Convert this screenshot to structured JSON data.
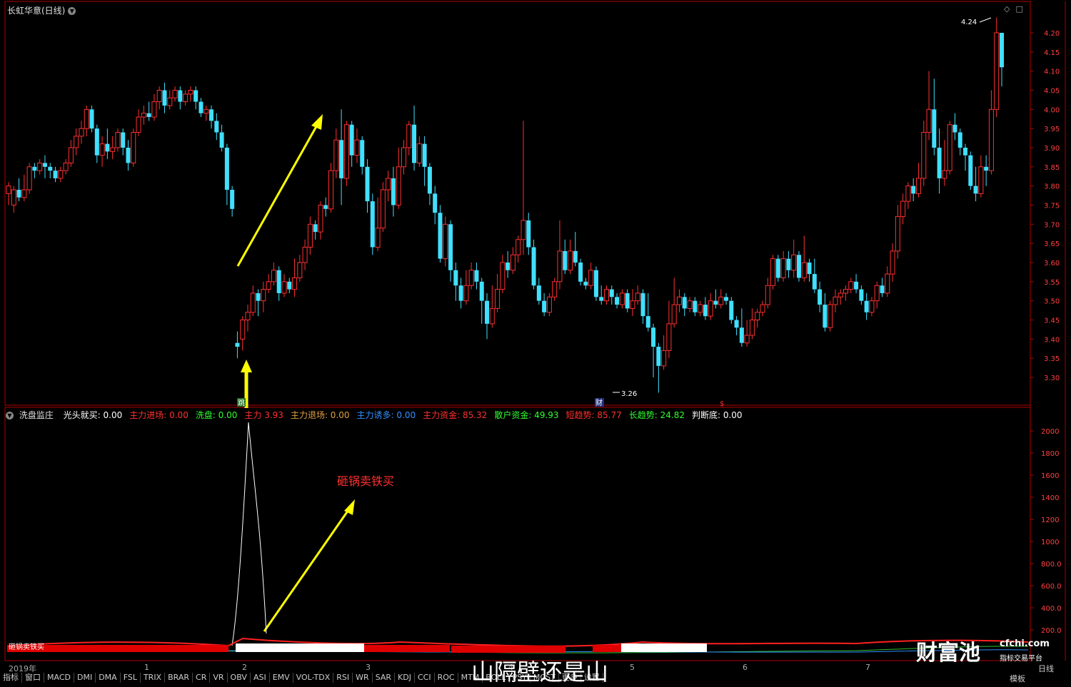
{
  "window": {
    "title": "长虹华意(日线)",
    "period_label": "日线",
    "template_label": "模板"
  },
  "price_axis": {
    "ticks": [
      "4.20",
      "4.15",
      "4.10",
      "4.05",
      "4.00",
      "3.95",
      "3.90",
      "3.85",
      "3.80",
      "3.75",
      "3.70",
      "3.65",
      "3.60",
      "3.55",
      "3.50",
      "3.45",
      "3.40",
      "3.35",
      "3.30"
    ],
    "high_label": "4.24",
    "low_label": "3.26"
  },
  "indicator_axis": {
    "ticks": [
      "2000",
      "1800",
      "1600",
      "1400",
      "1200",
      "1000",
      "800.0",
      "600.0",
      "400.0",
      "200.0"
    ]
  },
  "indicator": {
    "name": "洗盘监庄",
    "fields": [
      {
        "label": "光头就买:",
        "value": "0.00",
        "color": "#ffffff"
      },
      {
        "label": "主力进场:",
        "value": "0.00",
        "color": "#ff3030"
      },
      {
        "label": "洗盘:",
        "value": "0.00",
        "color": "#30ff30"
      },
      {
        "label": "主力",
        "value": "3.93",
        "color": "#ff3030"
      },
      {
        "label": "主力退场:",
        "value": "0.00",
        "color": "#e0a040"
      },
      {
        "label": "主力诱多:",
        "value": "0.00",
        "color": "#3090ff"
      },
      {
        "label": "主力资金:",
        "value": "85.32",
        "color": "#ff3030"
      },
      {
        "label": "散户资金:",
        "value": "49.93",
        "color": "#30ff30"
      },
      {
        "label": "短趋势:",
        "value": "85.77",
        "color": "#ff3030"
      },
      {
        "label": "长趋势:",
        "value": "24.82",
        "color": "#30ff30"
      },
      {
        "label": "判断底:",
        "value": "0.00",
        "color": "#ffffff"
      }
    ]
  },
  "markers": {
    "jump": "跳",
    "cai": "财",
    "dollar": "$"
  },
  "annotation": "砸锅卖铁买",
  "indicator_bar_text": "砸锅卖铁买",
  "date_axis": [
    "2019年",
    "1",
    "2",
    "3",
    "4",
    "5",
    "6",
    "7"
  ],
  "tabs": [
    "指标",
    "窗口",
    "MACD",
    "DMI",
    "DMA",
    "FSL",
    "TRIX",
    "BRAR",
    "CR",
    "VR",
    "OBV",
    "ASI",
    "EMV",
    "VOL-TDX",
    "RSI",
    "WR",
    "SAR",
    "KDJ",
    "CCI",
    "ROC",
    "MTM",
    "BOLL",
    "PSY",
    "MCST",
    "更多",
    "设置"
  ],
  "watermark": "山隔壁还是山",
  "logo": {
    "name": "财富池",
    "url": "cfchi.com",
    "sub": "指标交易平台"
  },
  "candles": [
    [
      3.78,
      3.8,
      3.75,
      3.81
    ],
    [
      3.75,
      3.79,
      3.73,
      3.8
    ],
    [
      3.79,
      3.77,
      3.76,
      3.82
    ],
    [
      3.77,
      3.79,
      3.76,
      3.83
    ],
    [
      3.79,
      3.85,
      3.78,
      3.86
    ],
    [
      3.85,
      3.84,
      3.82,
      3.86
    ],
    [
      3.84,
      3.86,
      3.83,
      3.87
    ],
    [
      3.86,
      3.85,
      3.82,
      3.88
    ],
    [
      3.85,
      3.84,
      3.82,
      3.86
    ],
    [
      3.84,
      3.82,
      3.81,
      3.85
    ],
    [
      3.82,
      3.84,
      3.81,
      3.85
    ],
    [
      3.84,
      3.86,
      3.83,
      3.87
    ],
    [
      3.86,
      3.9,
      3.85,
      3.92
    ],
    [
      3.9,
      3.93,
      3.88,
      3.95
    ],
    [
      3.93,
      3.95,
      3.91,
      3.97
    ],
    [
      3.95,
      4.0,
      3.93,
      4.01
    ],
    [
      4.0,
      3.95,
      3.94,
      4.01
    ],
    [
      3.95,
      3.88,
      3.86,
      3.96
    ],
    [
      3.88,
      3.91,
      3.85,
      3.93
    ],
    [
      3.91,
      3.89,
      3.87,
      3.95
    ],
    [
      3.89,
      3.9,
      3.87,
      3.93
    ],
    [
      3.9,
      3.94,
      3.89,
      3.95
    ],
    [
      3.94,
      3.9,
      3.88,
      3.95
    ],
    [
      3.9,
      3.86,
      3.84,
      3.92
    ],
    [
      3.86,
      3.94,
      3.85,
      3.95
    ],
    [
      3.94,
      3.98,
      3.93,
      4.0
    ],
    [
      3.98,
      3.99,
      3.96,
      4.01
    ],
    [
      3.99,
      3.98,
      3.97,
      4.02
    ],
    [
      3.98,
      4.02,
      3.97,
      4.04
    ],
    [
      4.02,
      4.05,
      4.0,
      4.06
    ],
    [
      4.05,
      4.01,
      3.99,
      4.07
    ],
    [
      4.01,
      4.03,
      4.0,
      4.05
    ],
    [
      4.03,
      4.05,
      4.02,
      4.06
    ],
    [
      4.05,
      4.02,
      4.0,
      4.06
    ],
    [
      4.02,
      4.04,
      4.01,
      4.05
    ],
    [
      4.04,
      4.05,
      4.02,
      4.06
    ],
    [
      4.05,
      4.02,
      4.0,
      4.06
    ],
    [
      4.02,
      3.99,
      3.98,
      4.03
    ],
    [
      3.99,
      4.0,
      3.97,
      4.01
    ],
    [
      4.0,
      3.97,
      3.95,
      4.01
    ],
    [
      3.97,
      3.94,
      3.92,
      3.99
    ],
    [
      3.94,
      3.9,
      3.89,
      3.96
    ],
    [
      3.9,
      3.79,
      3.75,
      3.91
    ],
    [
      3.79,
      3.74,
      3.72,
      3.8
    ],
    [
      3.39,
      3.38,
      3.35,
      3.42
    ],
    [
      3.4,
      3.45,
      3.37,
      3.46
    ],
    [
      3.45,
      3.47,
      3.42,
      3.49
    ],
    [
      3.47,
      3.52,
      3.46,
      3.54
    ],
    [
      3.52,
      3.5,
      3.46,
      3.53
    ],
    [
      3.5,
      3.53,
      3.47,
      3.55
    ],
    [
      3.53,
      3.55,
      3.52,
      3.57
    ],
    [
      3.55,
      3.58,
      3.54,
      3.6
    ],
    [
      3.58,
      3.52,
      3.5,
      3.59
    ],
    [
      3.52,
      3.55,
      3.51,
      3.57
    ],
    [
      3.55,
      3.53,
      3.52,
      3.56
    ],
    [
      3.53,
      3.56,
      3.51,
      3.61
    ],
    [
      3.56,
      3.6,
      3.55,
      3.62
    ],
    [
      3.6,
      3.64,
      3.58,
      3.66
    ],
    [
      3.64,
      3.7,
      3.62,
      3.72
    ],
    [
      3.7,
      3.68,
      3.66,
      3.71
    ],
    [
      3.68,
      3.75,
      3.66,
      3.76
    ],
    [
      3.75,
      3.74,
      3.72,
      3.77
    ],
    [
      3.74,
      3.84,
      3.73,
      3.86
    ],
    [
      3.84,
      3.92,
      3.82,
      3.95
    ],
    [
      3.92,
      3.82,
      3.75,
      4.0
    ],
    [
      3.82,
      3.96,
      3.8,
      3.97
    ],
    [
      3.96,
      3.88,
      3.85,
      3.97
    ],
    [
      3.88,
      3.92,
      3.86,
      3.95
    ],
    [
      3.92,
      3.85,
      3.83,
      3.93
    ],
    [
      3.85,
      3.76,
      3.73,
      3.87
    ],
    [
      3.76,
      3.64,
      3.62,
      3.78
    ],
    [
      3.64,
      3.69,
      3.63,
      3.77
    ],
    [
      3.69,
      3.79,
      3.68,
      3.81
    ],
    [
      3.79,
      3.82,
      3.76,
      3.84
    ],
    [
      3.82,
      3.75,
      3.72,
      3.85
    ],
    [
      3.75,
      3.85,
      3.74,
      3.9
    ],
    [
      3.85,
      3.9,
      3.83,
      3.92
    ],
    [
      3.9,
      3.96,
      3.88,
      3.97
    ],
    [
      3.96,
      3.86,
      3.84,
      4.01
    ],
    [
      3.86,
      3.91,
      3.85,
      3.93
    ],
    [
      3.91,
      3.85,
      3.8,
      3.93
    ],
    [
      3.85,
      3.78,
      3.75,
      3.86
    ],
    [
      3.78,
      3.73,
      3.7,
      3.8
    ],
    [
      3.73,
      3.61,
      3.6,
      3.75
    ],
    [
      3.61,
      3.7,
      3.59,
      3.72
    ],
    [
      3.7,
      3.58,
      3.55,
      3.71
    ],
    [
      3.58,
      3.54,
      3.5,
      3.6
    ],
    [
      3.54,
      3.5,
      3.48,
      3.56
    ],
    [
      3.5,
      3.54,
      3.49,
      3.58
    ],
    [
      3.54,
      3.58,
      3.53,
      3.6
    ],
    [
      3.58,
      3.55,
      3.53,
      3.6
    ],
    [
      3.55,
      3.5,
      3.44,
      3.56
    ],
    [
      3.5,
      3.44,
      3.4,
      3.52
    ],
    [
      3.44,
      3.48,
      3.43,
      3.54
    ],
    [
      3.48,
      3.53,
      3.47,
      3.57
    ],
    [
      3.53,
      3.6,
      3.52,
      3.62
    ],
    [
      3.6,
      3.58,
      3.56,
      3.63
    ],
    [
      3.58,
      3.62,
      3.57,
      3.64
    ],
    [
      3.62,
      3.66,
      3.6,
      3.67
    ],
    [
      3.66,
      3.71,
      3.62,
      3.97
    ],
    [
      3.71,
      3.64,
      3.62,
      3.73
    ],
    [
      3.64,
      3.54,
      3.53,
      3.66
    ],
    [
      3.54,
      3.5,
      3.49,
      3.56
    ],
    [
      3.5,
      3.47,
      3.46,
      3.52
    ],
    [
      3.47,
      3.51,
      3.46,
      3.52
    ],
    [
      3.51,
      3.55,
      3.5,
      3.56
    ],
    [
      3.55,
      3.63,
      3.53,
      3.71
    ],
    [
      3.63,
      3.58,
      3.57,
      3.66
    ],
    [
      3.58,
      3.63,
      3.57,
      3.66
    ],
    [
      3.63,
      3.6,
      3.59,
      3.68
    ],
    [
      3.6,
      3.55,
      3.54,
      3.61
    ],
    [
      3.55,
      3.54,
      3.53,
      3.56
    ],
    [
      3.54,
      3.58,
      3.53,
      3.6
    ],
    [
      3.58,
      3.51,
      3.5,
      3.59
    ],
    [
      3.51,
      3.5,
      3.49,
      3.54
    ],
    [
      3.5,
      3.53,
      3.49,
      3.54
    ],
    [
      3.53,
      3.51,
      3.49,
      3.54
    ],
    [
      3.51,
      3.49,
      3.48,
      3.52
    ],
    [
      3.49,
      3.52,
      3.48,
      3.53
    ],
    [
      3.52,
      3.48,
      3.47,
      3.53
    ],
    [
      3.48,
      3.5,
      3.46,
      3.53
    ],
    [
      3.5,
      3.52,
      3.49,
      3.54
    ],
    [
      3.52,
      3.46,
      3.44,
      3.53
    ],
    [
      3.46,
      3.43,
      3.42,
      3.52
    ],
    [
      3.43,
      3.38,
      3.3,
      3.44
    ],
    [
      3.38,
      3.33,
      3.26,
      3.39
    ],
    [
      3.33,
      3.37,
      3.32,
      3.41
    ],
    [
      3.37,
      3.44,
      3.35,
      3.5
    ],
    [
      3.44,
      3.49,
      3.43,
      3.56
    ],
    [
      3.49,
      3.51,
      3.47,
      3.53
    ],
    [
      3.51,
      3.48,
      3.46,
      3.52
    ],
    [
      3.48,
      3.5,
      3.47,
      3.51
    ],
    [
      3.5,
      3.47,
      3.46,
      3.51
    ],
    [
      3.47,
      3.49,
      3.46,
      3.5
    ],
    [
      3.49,
      3.46,
      3.45,
      3.51
    ],
    [
      3.46,
      3.5,
      3.45,
      3.52
    ],
    [
      3.5,
      3.49,
      3.48,
      3.53
    ],
    [
      3.49,
      3.51,
      3.48,
      3.53
    ],
    [
      3.51,
      3.5,
      3.49,
      3.52
    ],
    [
      3.5,
      3.45,
      3.44,
      3.51
    ],
    [
      3.45,
      3.43,
      3.41,
      3.46
    ],
    [
      3.43,
      3.39,
      3.38,
      3.48
    ],
    [
      3.39,
      3.41,
      3.38,
      3.45
    ],
    [
      3.41,
      3.45,
      3.4,
      3.48
    ],
    [
      3.45,
      3.47,
      3.43,
      3.48
    ],
    [
      3.47,
      3.49,
      3.46,
      3.5
    ],
    [
      3.49,
      3.54,
      3.48,
      3.56
    ],
    [
      3.54,
      3.61,
      3.53,
      3.62
    ],
    [
      3.61,
      3.56,
      3.55,
      3.62
    ],
    [
      3.56,
      3.61,
      3.55,
      3.63
    ],
    [
      3.61,
      3.58,
      3.56,
      3.63
    ],
    [
      3.58,
      3.62,
      3.56,
      3.66
    ],
    [
      3.62,
      3.56,
      3.55,
      3.63
    ],
    [
      3.56,
      3.6,
      3.55,
      3.67
    ],
    [
      3.6,
      3.57,
      3.55,
      3.61
    ],
    [
      3.57,
      3.53,
      3.52,
      3.61
    ],
    [
      3.53,
      3.49,
      3.47,
      3.55
    ],
    [
      3.49,
      3.43,
      3.42,
      3.52
    ],
    [
      3.43,
      3.49,
      3.42,
      3.5
    ],
    [
      3.49,
      3.51,
      3.47,
      3.53
    ],
    [
      3.51,
      3.52,
      3.49,
      3.53
    ],
    [
      3.52,
      3.53,
      3.5,
      3.54
    ],
    [
      3.53,
      3.55,
      3.52,
      3.56
    ],
    [
      3.55,
      3.53,
      3.52,
      3.57
    ],
    [
      3.53,
      3.5,
      3.49,
      3.54
    ],
    [
      3.5,
      3.47,
      3.45,
      3.52
    ],
    [
      3.47,
      3.5,
      3.46,
      3.51
    ],
    [
      3.5,
      3.54,
      3.48,
      3.55
    ],
    [
      3.54,
      3.52,
      3.51,
      3.56
    ],
    [
      3.52,
      3.57,
      3.51,
      3.59
    ],
    [
      3.57,
      3.63,
      3.55,
      3.65
    ],
    [
      3.63,
      3.72,
      3.61,
      3.75
    ],
    [
      3.72,
      3.76,
      3.7,
      3.78
    ],
    [
      3.76,
      3.8,
      3.74,
      3.81
    ],
    [
      3.8,
      3.78,
      3.76,
      3.82
    ],
    [
      3.78,
      3.82,
      3.77,
      3.86
    ],
    [
      3.82,
      3.94,
      3.8,
      3.97
    ],
    [
      3.94,
      4.0,
      3.92,
      4.1
    ],
    [
      4.0,
      3.9,
      3.88,
      4.08
    ],
    [
      3.9,
      3.82,
      3.78,
      3.95
    ],
    [
      3.82,
      3.84,
      3.8,
      3.92
    ],
    [
      3.84,
      3.96,
      3.83,
      3.97
    ],
    [
      3.96,
      3.94,
      3.92,
      3.99
    ],
    [
      3.94,
      3.9,
      3.88,
      3.95
    ],
    [
      3.9,
      3.88,
      3.84,
      3.91
    ],
    [
      3.88,
      3.8,
      3.79,
      3.89
    ],
    [
      3.8,
      3.78,
      3.76,
      3.85
    ],
    [
      3.78,
      3.85,
      3.77,
      3.88
    ],
    [
      3.85,
      3.84,
      3.8,
      3.88
    ],
    [
      3.84,
      4.0,
      3.83,
      4.05
    ],
    [
      4.0,
      4.2,
      3.98,
      4.24
    ],
    [
      4.2,
      4.11,
      4.06,
      4.13
    ]
  ]
}
